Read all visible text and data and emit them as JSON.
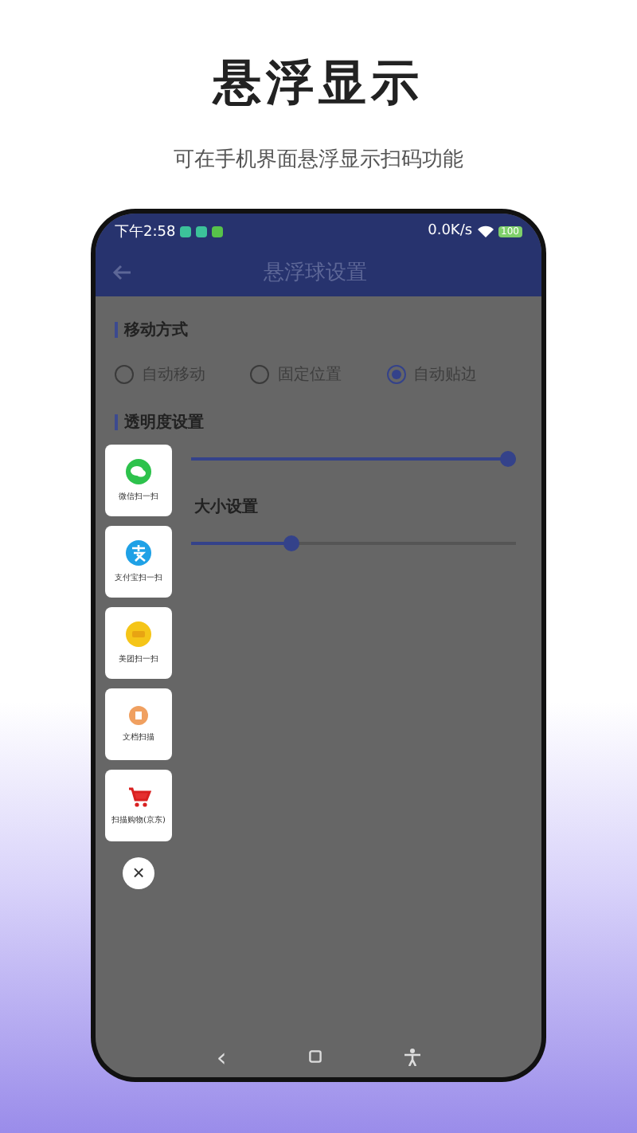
{
  "header": {
    "title": "悬浮显示",
    "subtitle": "可在手机界面悬浮显示扫码功能"
  },
  "status_bar": {
    "time": "下午2:58",
    "speed": "0.0K/s",
    "battery": "100"
  },
  "app_bar": {
    "title": "悬浮球设置"
  },
  "move_section": {
    "title": "移动方式",
    "options": [
      {
        "label": "自动移动",
        "selected": false
      },
      {
        "label": "固定位置",
        "selected": false
      },
      {
        "label": "自动贴边",
        "selected": true
      }
    ]
  },
  "opacity_section": {
    "title": "透明度设置",
    "level": 1.0
  },
  "size_section": {
    "title": "大小设置",
    "level": 0.3
  },
  "float_menu": {
    "items": [
      {
        "kind": "wechat",
        "label": "微信扫一扫"
      },
      {
        "kind": "alipay",
        "label": "支付宝扫一扫"
      },
      {
        "kind": "meituan",
        "label": "美团扫一扫"
      },
      {
        "kind": "doc",
        "label": "文档扫描"
      },
      {
        "kind": "cart",
        "label": "扫描购物(京东)"
      }
    ],
    "close": "×"
  },
  "nav_bar": {
    "back": "‹"
  }
}
